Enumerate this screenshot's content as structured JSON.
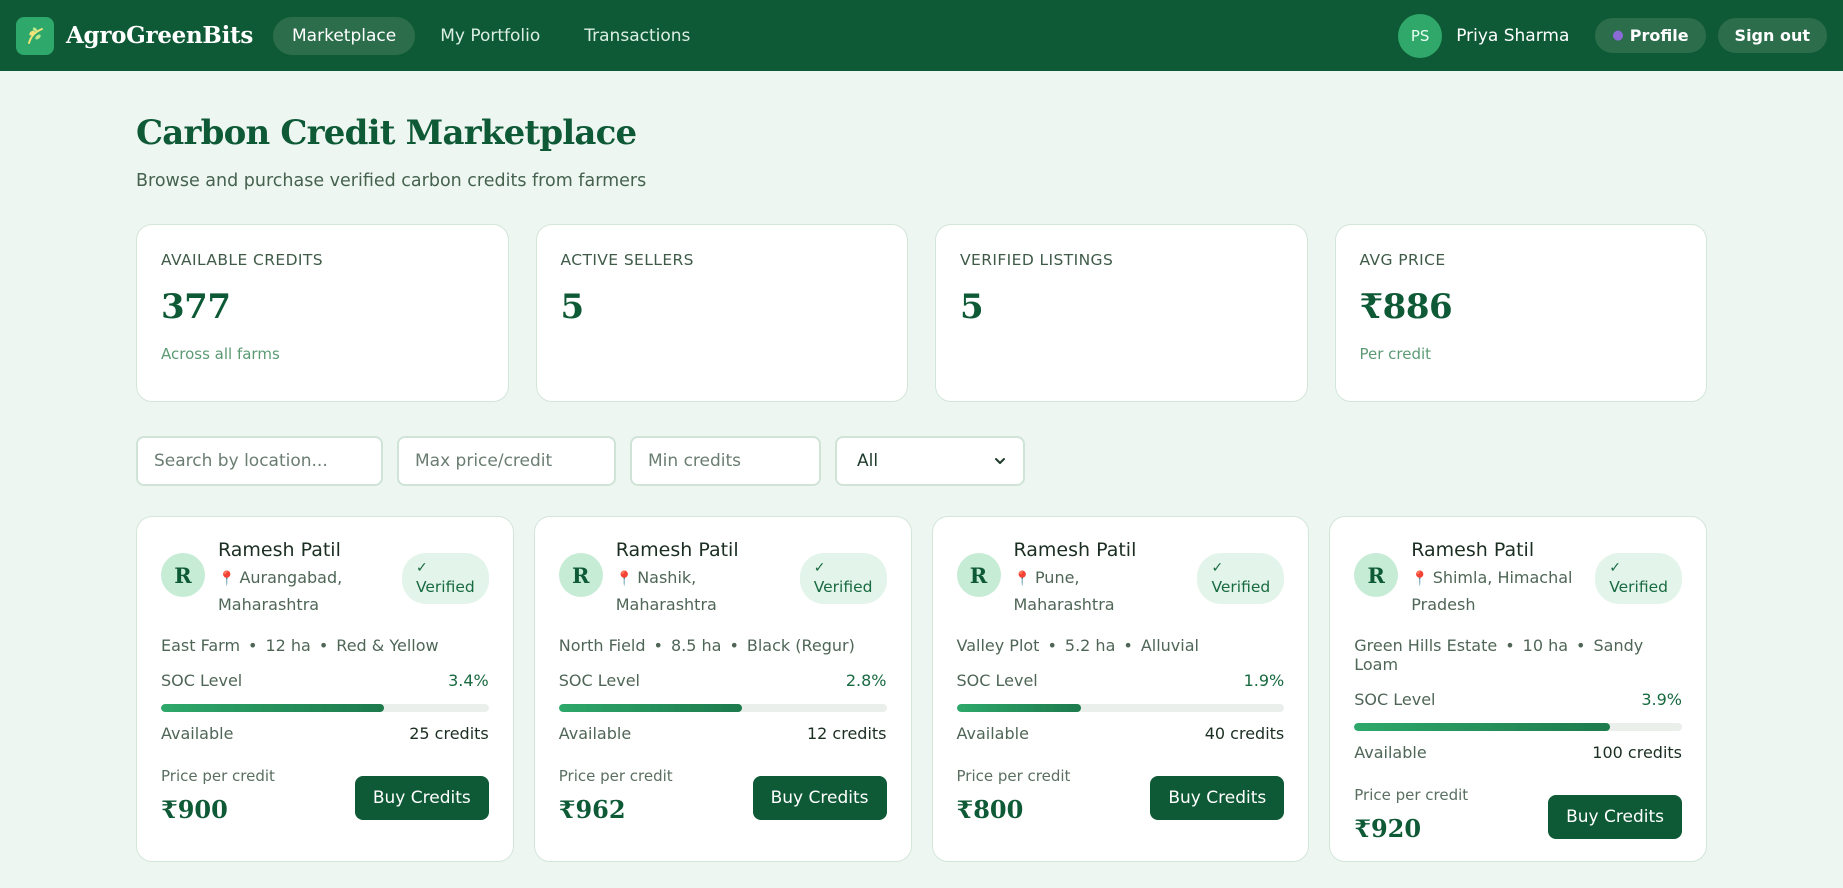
{
  "nav": {
    "brand": "AgroGreenBits",
    "links": [
      {
        "label": "Marketplace",
        "active": true
      },
      {
        "label": "My Portfolio",
        "active": false
      },
      {
        "label": "Transactions",
        "active": false
      }
    ],
    "user_initials": "PS",
    "user_name": "Priya Sharma",
    "profile_label": "Profile",
    "signout_label": "Sign out"
  },
  "header": {
    "title": "Carbon Credit Marketplace",
    "subtitle": "Browse and purchase verified carbon credits from farmers"
  },
  "stats": [
    {
      "label": "AVAILABLE CREDITS",
      "value": "377",
      "note": "Across all farms"
    },
    {
      "label": "ACTIVE SELLERS",
      "value": "5",
      "note": ""
    },
    {
      "label": "VERIFIED LISTINGS",
      "value": "5",
      "note": ""
    },
    {
      "label": "AVG PRICE",
      "value": "₹886",
      "note": "Per credit"
    }
  ],
  "filters": {
    "search_placeholder": "Search by location...",
    "max_price_placeholder": "Max price/credit",
    "min_credits_placeholder": "Min credits",
    "select_value": "All"
  },
  "listings": [
    {
      "initial": "R",
      "seller": "Ramesh Patil",
      "location_line1": "Aurangabad,",
      "location_line2": "Maharashtra",
      "badge_check": "✓",
      "badge": "Verified",
      "farm": "East Farm",
      "area": "12 ha",
      "soil": "Red & Yellow",
      "soc_label": "SOC Level",
      "soc": "3.4%",
      "soc_fraction": 0.68,
      "available_label": "Available",
      "available": "25 credits",
      "price_label": "Price per credit",
      "price": "₹900",
      "buy_label": "Buy Credits"
    },
    {
      "initial": "R",
      "seller": "Ramesh Patil",
      "location_line1": "Nashik,",
      "location_line2": "Maharashtra",
      "badge_check": "✓",
      "badge": "Verified",
      "farm": "North Field",
      "area": "8.5 ha",
      "soil": "Black (Regur)",
      "soc_label": "SOC Level",
      "soc": "2.8%",
      "soc_fraction": 0.56,
      "available_label": "Available",
      "available": "12 credits",
      "price_label": "Price per credit",
      "price": "₹962",
      "buy_label": "Buy Credits"
    },
    {
      "initial": "R",
      "seller": "Ramesh Patil",
      "location_line1": "Pune,",
      "location_line2": "Maharashtra",
      "badge_check": "✓",
      "badge": "Verified",
      "farm": "Valley Plot",
      "area": "5.2 ha",
      "soil": "Alluvial",
      "soc_label": "SOC Level",
      "soc": "1.9%",
      "soc_fraction": 0.38,
      "available_label": "Available",
      "available": "40 credits",
      "price_label": "Price per credit",
      "price": "₹800",
      "buy_label": "Buy Credits"
    },
    {
      "initial": "R",
      "seller": "Ramesh Patil",
      "location_line1": "Shimla, Himachal",
      "location_line2": "Pradesh",
      "badge_check": "✓",
      "badge": "Verified",
      "farm": "Green Hills Estate",
      "area": "10 ha",
      "soil": "Sandy Loam",
      "soc_label": "SOC Level",
      "soc": "3.9%",
      "soc_fraction": 0.78,
      "available_label": "Available",
      "available": "100 credits",
      "price_label": "Price per credit",
      "price": "₹920",
      "buy_label": "Buy Credits"
    }
  ],
  "icons": {
    "logo": "leaf-logo-icon",
    "profile": "person-icon",
    "location": "map-pin-icon",
    "select": "chevron-down-icon"
  },
  "colors": {
    "brand": "#0f5a36",
    "accent": "#2ea86b",
    "background": "#eef6f1"
  }
}
